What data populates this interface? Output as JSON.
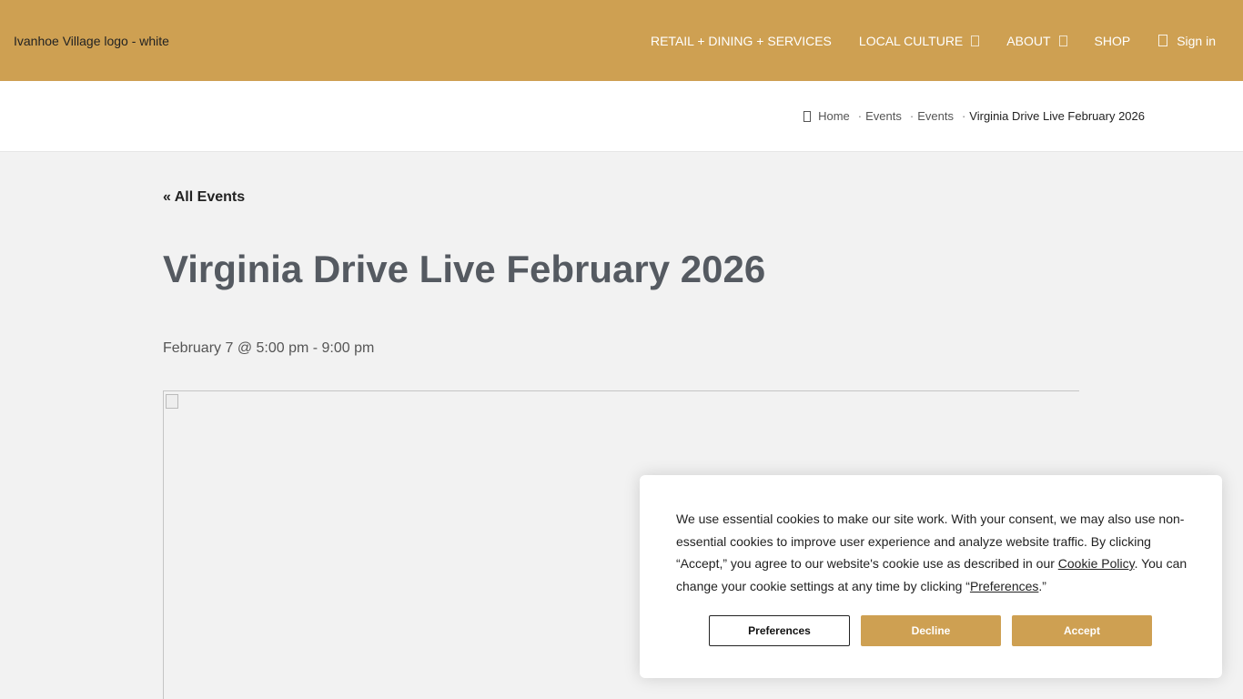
{
  "header": {
    "logo_alt": "Ivanhoe Village logo - white",
    "brand_color": "#cea052",
    "nav": [
      {
        "label": "RETAIL + DINING + SERVICES"
      },
      {
        "label": "LOCAL CULTURE"
      },
      {
        "label": "ABOUT"
      },
      {
        "label": "SHOP"
      },
      {
        "label": "Sign in"
      }
    ]
  },
  "breadcrumb": {
    "items": [
      "Home",
      "Events",
      "Events"
    ],
    "current": "Virginia Drive Live February 2026",
    "separator": "·"
  },
  "event": {
    "back_link": "« All Events",
    "title": "Virginia Drive Live February 2026",
    "date": "February 7 @ 5:00 pm - 9:00 pm"
  },
  "cookie_banner": {
    "text_1": "We use essential cookies to make our site work. With your consent, we may also use non-essential cookies to improve user experience and analyze website traffic. By clicking “Accept,” you agree to our website's cookie use as described in our ",
    "policy_link": "Cookie Policy",
    "text_2": ". You can change your cookie settings at any time by clicking “",
    "preferences_link": "Preferences",
    "text_3": ".”",
    "buttons": {
      "preferences": "Preferences",
      "decline": "Decline",
      "accept": "Accept"
    }
  }
}
